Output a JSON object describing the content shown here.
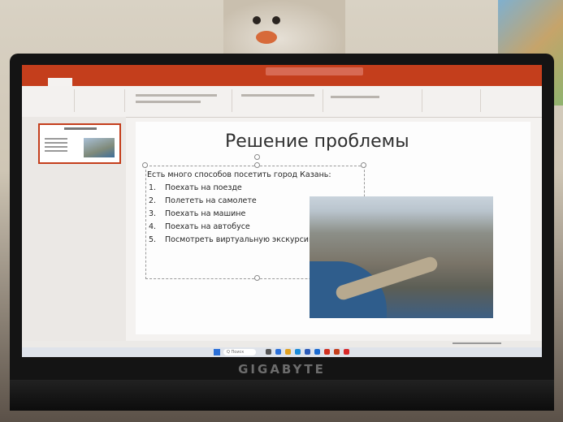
{
  "slide": {
    "title": "Решение проблемы",
    "intro": "Есть много способов посетить город Казань:",
    "items": [
      {
        "num": "1.",
        "text": "Поехать на поезде"
      },
      {
        "num": "2.",
        "text": "Полететь на самолете"
      },
      {
        "num": "3.",
        "text": "Поехать на машине"
      },
      {
        "num": "4.",
        "text": "Поехать на автобусе"
      },
      {
        "num": "5.",
        "text": "Посмотреть виртуальную экскурсию"
      }
    ]
  },
  "laptop": {
    "brand": "GIGABYTE"
  },
  "taskbar": {
    "search_label": "Q Поиск"
  },
  "colors": {
    "ribbon": "#c43e1c",
    "slide_bg": "#fdfdfd",
    "laptop_bezel": "#141414"
  },
  "icons": [
    "windows-icon",
    "search-icon",
    "powerpoint-icon",
    "browser-icon"
  ]
}
